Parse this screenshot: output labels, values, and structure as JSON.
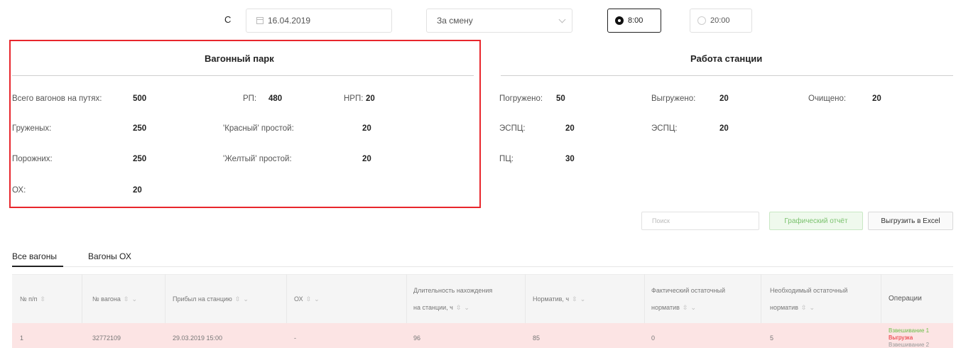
{
  "filters": {
    "from_label": "С",
    "date": "16.04.2019",
    "period": "За смену",
    "shift_options": [
      {
        "label": "8:00",
        "selected": true
      },
      {
        "label": "20:00",
        "selected": false
      }
    ]
  },
  "wagon_park": {
    "title": "Вагонный парк",
    "total_label": "Всего вагонов на путях:",
    "total_value": "500",
    "rp_label": "РП:",
    "rp_value": "480",
    "nrp_label": "НРП:",
    "nrp_value": "20",
    "loaded_label": "Груженых:",
    "loaded_value": "250",
    "red_label": "'Красный' простой:",
    "red_value": "20",
    "empty_label": "Порожних:",
    "empty_value": "250",
    "yellow_label": "'Желтый' простой:",
    "yellow_value": "20",
    "ox_label": "ОХ:",
    "ox_value": "20"
  },
  "station_work": {
    "title": "Работа станции",
    "loaded_label": "Погружено:",
    "loaded_value": "50",
    "unloaded_label": "Выгружено:",
    "unloaded_value": "20",
    "cleaned_label": "Очищено:",
    "cleaned_value": "20",
    "espc1_label": "ЭСПЦ:",
    "espc1_value": "20",
    "espc2_label": "ЭСПЦ:",
    "espc2_value": "20",
    "pc_label": "ПЦ:",
    "pc_value": "30"
  },
  "actions": {
    "search_placeholder": "Поиск",
    "graph_button": "Графический отчёт",
    "excel_button": "Выгрузить в Excel"
  },
  "tabs": [
    "Все вагоны",
    "Вагоны ОХ"
  ],
  "table": {
    "headers": {
      "num": "№ п/п",
      "wagon": "№ вагона",
      "arrived": "Прибыл на станцию",
      "ox": "ОХ",
      "duration_l1": "Длительность нахождения",
      "duration_l2": "на станции, ч",
      "norm": "Норматив, ч",
      "actual_l1": "Фактический остаточный",
      "actual_l2": "норматив",
      "required_l1": "Необходимый остаточный",
      "required_l2": "норматив",
      "ops": "Операции"
    },
    "rows": [
      {
        "num": "1",
        "wagon": "32772109",
        "arrived": "29.03.2019 15:00",
        "ox": "-",
        "duration": "96",
        "norm": "85",
        "actual": "0",
        "required": "5",
        "op1": "Взвешивание 1",
        "op2": "Выгрузка",
        "op3": "Взвешивание 2"
      }
    ]
  },
  "colors": {
    "highlight_border": "#e8262c",
    "row_highlight": "#fce4e4",
    "green_button": "#7bc26e",
    "op_green": "#6cc04a",
    "op_red": "#e8262c",
    "op_gray": "#999999"
  }
}
